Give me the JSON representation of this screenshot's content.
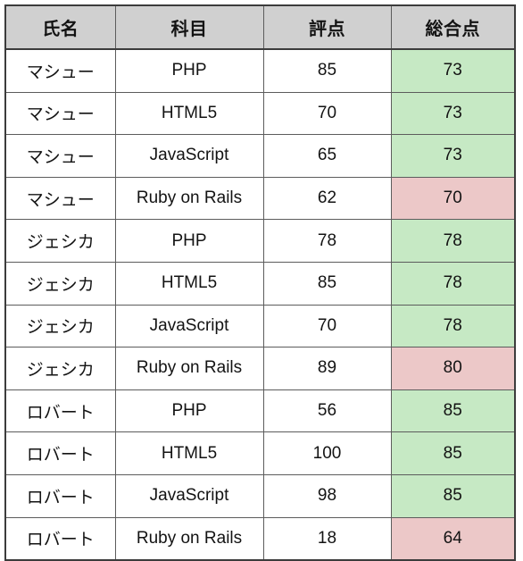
{
  "table": {
    "caption": "",
    "columns": [
      {
        "key": "name",
        "label": "氏名"
      },
      {
        "key": "subject",
        "label": "科目"
      },
      {
        "key": "score",
        "label": "評点"
      },
      {
        "key": "total",
        "label": "総合点"
      }
    ],
    "header_bg": "#d0d0d0",
    "highlight_colors": {
      "green": "#c6e9c4",
      "pink": "#ecc8c8",
      "none": "#ffffff"
    },
    "border_color": "#5c5c5c",
    "outer_border_color": "#3c3c3c",
    "rows": [
      {
        "name": "マシュー",
        "subject": "PHP",
        "score": "85",
        "total": "73",
        "total_highlight": "green"
      },
      {
        "name": "マシュー",
        "subject": "HTML5",
        "score": "70",
        "total": "73",
        "total_highlight": "green"
      },
      {
        "name": "マシュー",
        "subject": "JavaScript",
        "score": "65",
        "total": "73",
        "total_highlight": "green"
      },
      {
        "name": "マシュー",
        "subject": "Ruby on Rails",
        "score": "62",
        "total": "70",
        "total_highlight": "pink"
      },
      {
        "name": "ジェシカ",
        "subject": "PHP",
        "score": "78",
        "total": "78",
        "total_highlight": "green"
      },
      {
        "name": "ジェシカ",
        "subject": "HTML5",
        "score": "85",
        "total": "78",
        "total_highlight": "green"
      },
      {
        "name": "ジェシカ",
        "subject": "JavaScript",
        "score": "70",
        "total": "78",
        "total_highlight": "green"
      },
      {
        "name": "ジェシカ",
        "subject": "Ruby on Rails",
        "score": "89",
        "total": "80",
        "total_highlight": "pink"
      },
      {
        "name": "ロバート",
        "subject": "PHP",
        "score": "56",
        "total": "85",
        "total_highlight": "green"
      },
      {
        "name": "ロバート",
        "subject": "HTML5",
        "score": "100",
        "total": "85",
        "total_highlight": "green"
      },
      {
        "name": "ロバート",
        "subject": "JavaScript",
        "score": "98",
        "total": "85",
        "total_highlight": "green"
      },
      {
        "name": "ロバート",
        "subject": "Ruby on Rails",
        "score": "18",
        "total": "64",
        "total_highlight": "pink"
      }
    ]
  }
}
